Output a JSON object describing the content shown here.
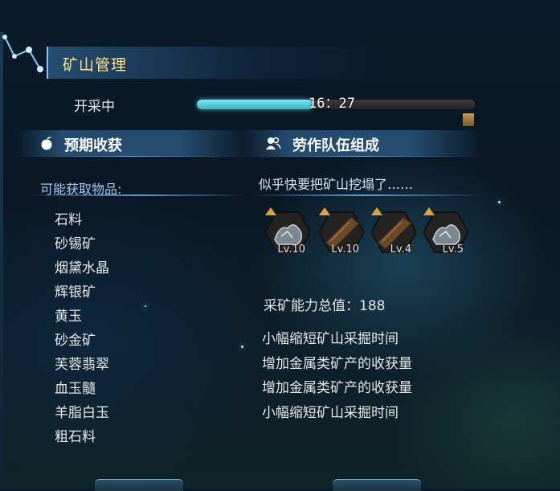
{
  "header": {
    "title": "矿山管理"
  },
  "mining": {
    "status": "开采中",
    "time": "16：27",
    "progress": 0.42
  },
  "harvest": {
    "heading": "预期收获",
    "available_label": "可能获取物品:",
    "items": [
      "石料",
      "砂锡矿",
      "烟黛水晶",
      "辉银矿",
      "黄玉",
      "砂金矿",
      "芙蓉翡翠",
      "血玉髓",
      "羊脂白玉",
      "粗石料"
    ]
  },
  "team": {
    "heading": "劳作队伍组成",
    "warning": "似乎快要把矿山挖塌了……",
    "workers": [
      {
        "level": "Lv.10",
        "icon": "ore-pile-icon"
      },
      {
        "level": "Lv.10",
        "icon": "mining-pick-icon"
      },
      {
        "level": "Lv.4",
        "icon": "mining-pick-icon"
      },
      {
        "level": "Lv.5",
        "icon": "ore-pile-icon"
      }
    ],
    "power": "采矿能力总值：188",
    "effects": [
      "小幅缩短矿山采掘时间",
      "增加金属类矿产的收获量",
      "增加金属类矿产的收获量",
      "小幅缩短矿山采掘时间"
    ]
  },
  "colors": {
    "accent": "#7fe6f2",
    "title": "#ffe28a",
    "subtle": "#a9c9f3"
  }
}
